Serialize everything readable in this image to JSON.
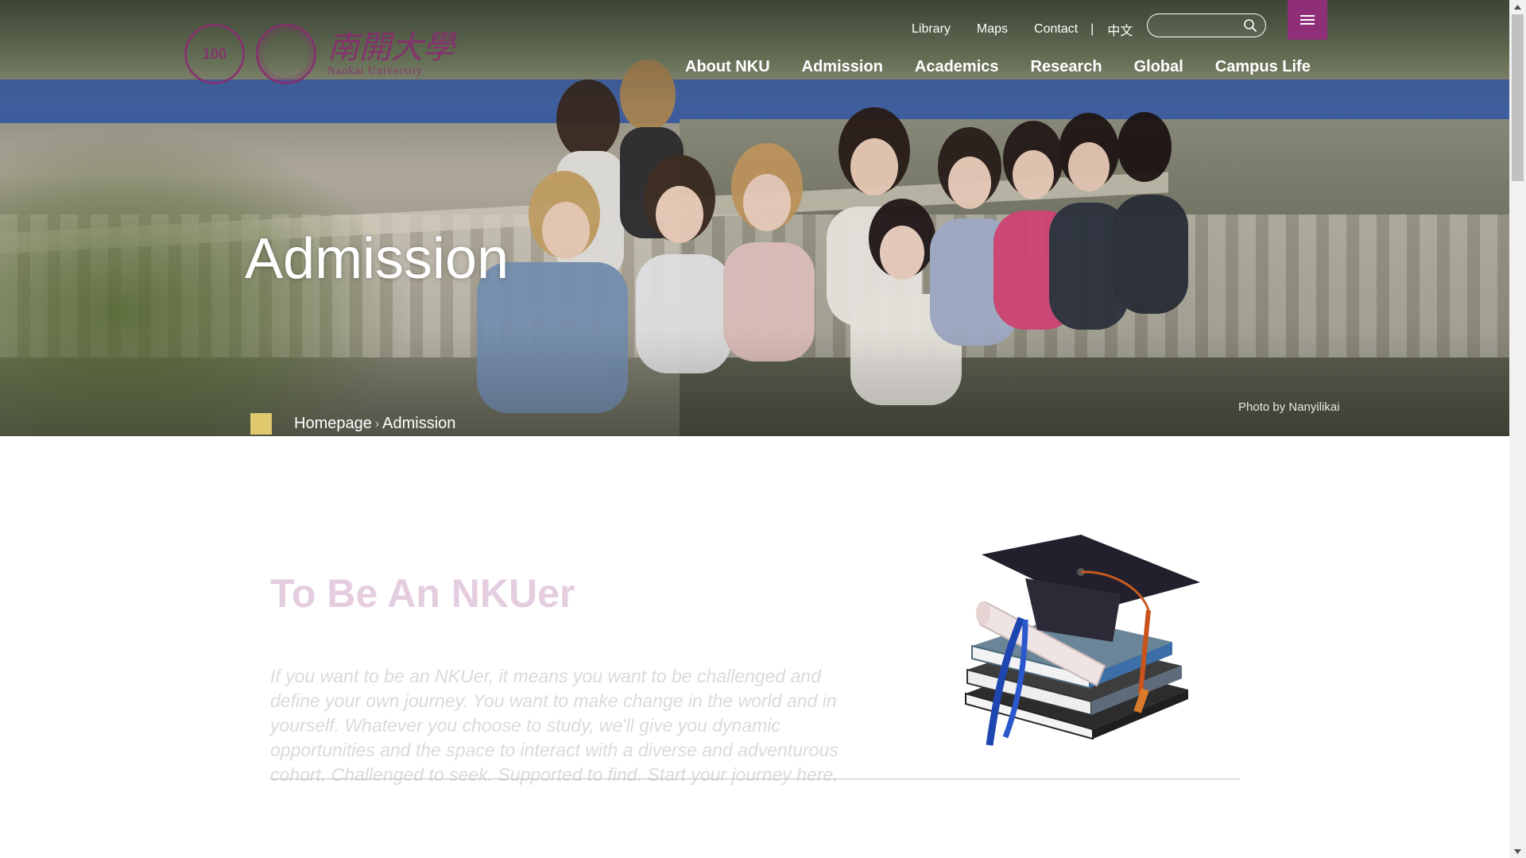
{
  "header": {
    "logo": {
      "badge": "100",
      "name_cn": "南開大學",
      "name_en": "Nankai University"
    },
    "utility_links": [
      "Library",
      "Maps",
      "Contact"
    ],
    "language": "中文",
    "search": {
      "value": "",
      "placeholder": ""
    },
    "nav": [
      "About NKU",
      "Admission",
      "Academics",
      "Research",
      "Global",
      "Campus Life"
    ]
  },
  "hero": {
    "title": "Admission",
    "photo_credit": "Photo by Nanyilikai",
    "breadcrumb": [
      "Homepage",
      "Admission"
    ]
  },
  "intro": {
    "title": "To Be An NKUer",
    "text": "If you want to be an NKUer, it means you want to be challenged and define your own journey. You want to make change in the world and in yourself. Whatever you choose to study, we'll give you dynamic opportunities and the space to interact with a diverse and adventurous cohort. Challenged to seek. Supported to find. Start your journey here."
  },
  "colors": {
    "brand_purple": "#8f2f78",
    "breadcrumb_accent": "#dfc86d"
  }
}
